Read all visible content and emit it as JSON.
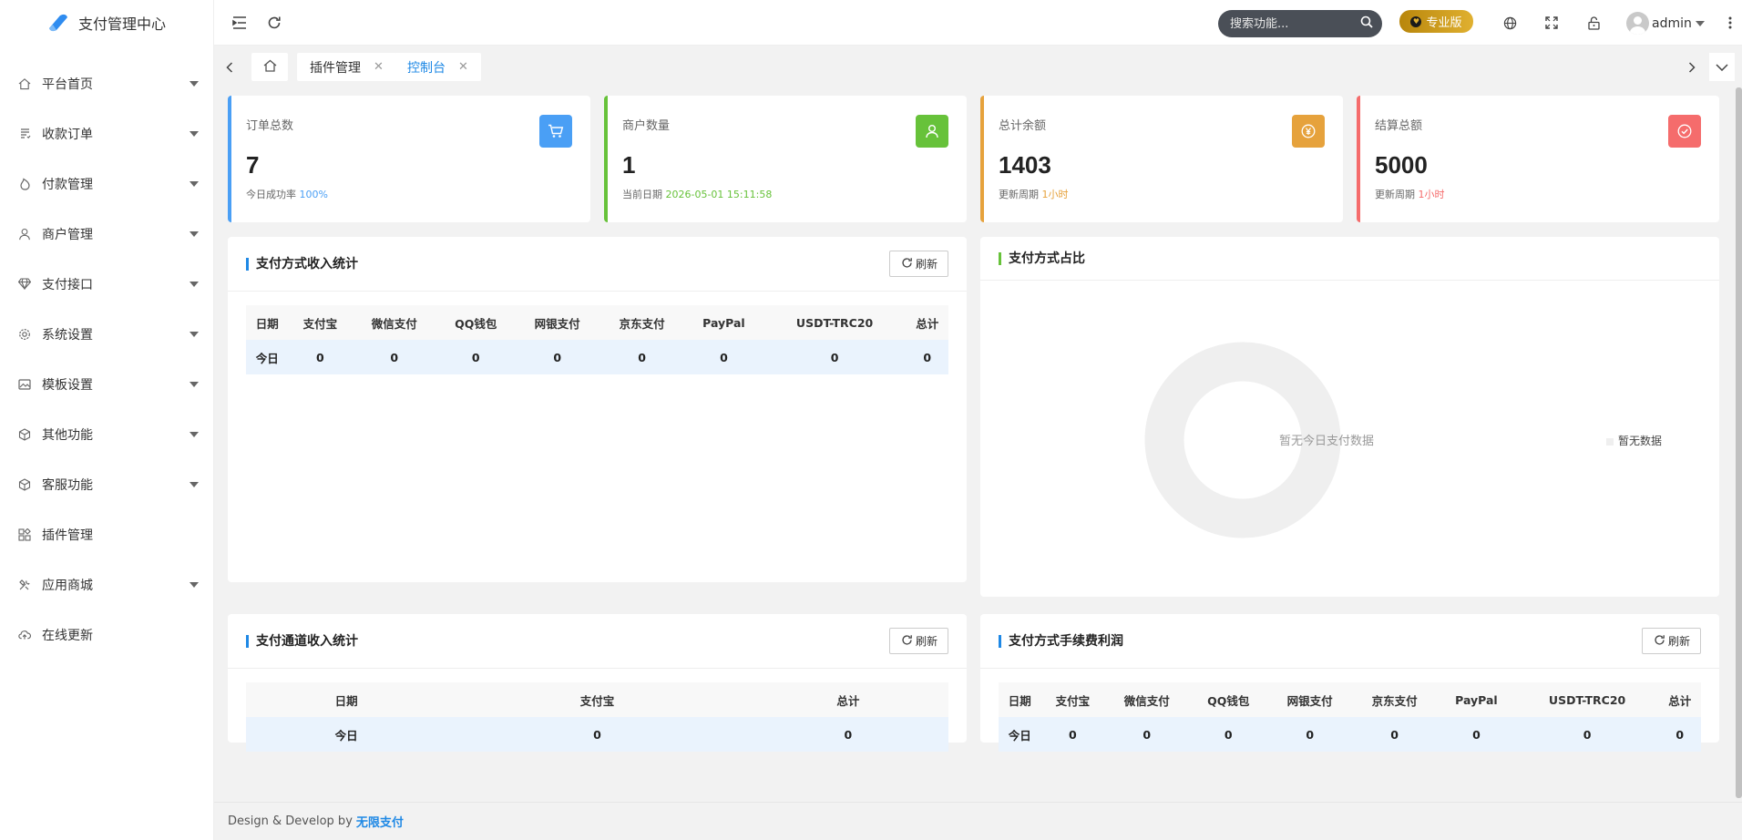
{
  "app": {
    "title": "支付管理中心"
  },
  "sidebar": {
    "items": [
      {
        "label": "平台首页",
        "icon": "home-icon",
        "has_caret": true
      },
      {
        "label": "收款订单",
        "icon": "list-icon",
        "has_caret": true
      },
      {
        "label": "付款管理",
        "icon": "fire-icon",
        "has_caret": true
      },
      {
        "label": "商户管理",
        "icon": "user-icon",
        "has_caret": true
      },
      {
        "label": "支付接口",
        "icon": "diamond-icon",
        "has_caret": true
      },
      {
        "label": "系统设置",
        "icon": "gear-icon",
        "has_caret": true
      },
      {
        "label": "模板设置",
        "icon": "image-icon",
        "has_caret": true
      },
      {
        "label": "其他功能",
        "icon": "cube-icon",
        "has_caret": true
      },
      {
        "label": "客服功能",
        "icon": "cube-icon",
        "has_caret": true
      },
      {
        "label": "插件管理",
        "icon": "apps-icon",
        "has_caret": false
      },
      {
        "label": "应用商城",
        "icon": "tools-icon",
        "has_caret": true
      },
      {
        "label": "在线更新",
        "icon": "cloud-upload-icon",
        "has_caret": false
      }
    ]
  },
  "header": {
    "search_placeholder": "搜索功能...",
    "pro_label": "专业版",
    "user_name": "admin"
  },
  "tabs": [
    {
      "label": "插件管理",
      "active": false
    },
    {
      "label": "控制台",
      "active": true
    }
  ],
  "stats": [
    {
      "title": "订单总数",
      "value": "7",
      "sub_label": "今日成功率",
      "sub_value": "100%",
      "color": "#4a9ff5",
      "icon": "cart-icon"
    },
    {
      "title": "商户数量",
      "value": "1",
      "sub_label": "当前日期",
      "sub_value": "2026-05-01 15:11:58",
      "color": "#67c23a",
      "icon": "user-icon"
    },
    {
      "title": "总计余额",
      "value": "1403",
      "sub_label": "更新周期",
      "sub_value": "1小时",
      "color": "#e6a23c",
      "icon": "yen-icon"
    },
    {
      "title": "结算总额",
      "value": "5000",
      "sub_label": "更新周期",
      "sub_value": "1小时",
      "color": "#f56c6c",
      "icon": "check-circle-icon"
    }
  ],
  "panels": {
    "pay_income": {
      "title": "支付方式收入统计",
      "refresh_label": "刷新",
      "columns": [
        "日期",
        "支付宝",
        "微信支付",
        "QQ钱包",
        "网银支付",
        "京东支付",
        "PayPal",
        "USDT-TRC20",
        "总计"
      ],
      "rows": [
        [
          "今日",
          "0",
          "0",
          "0",
          "0",
          "0",
          "0",
          "0",
          "0"
        ]
      ]
    },
    "pay_ratio": {
      "title": "支付方式占比",
      "empty_text": "暂无今日支付数据",
      "legend_label": "暂无数据",
      "accent": "#67c23a"
    },
    "channel_income": {
      "title": "支付通道收入统计",
      "refresh_label": "刷新",
      "columns": [
        "日期",
        "支付宝",
        "总计"
      ],
      "rows": [
        [
          "今日",
          "0",
          "0"
        ]
      ]
    },
    "fee_profit": {
      "title": "支付方式手续费利润",
      "refresh_label": "刷新",
      "columns": [
        "日期",
        "支付宝",
        "微信支付",
        "QQ钱包",
        "网银支付",
        "京东支付",
        "PayPal",
        "USDT-TRC20",
        "总计"
      ],
      "rows": [
        [
          "今日",
          "0",
          "0",
          "0",
          "0",
          "0",
          "0",
          "0",
          "0"
        ]
      ]
    }
  },
  "footer": {
    "text": "Design & Develop by",
    "brand": "无限支付"
  }
}
